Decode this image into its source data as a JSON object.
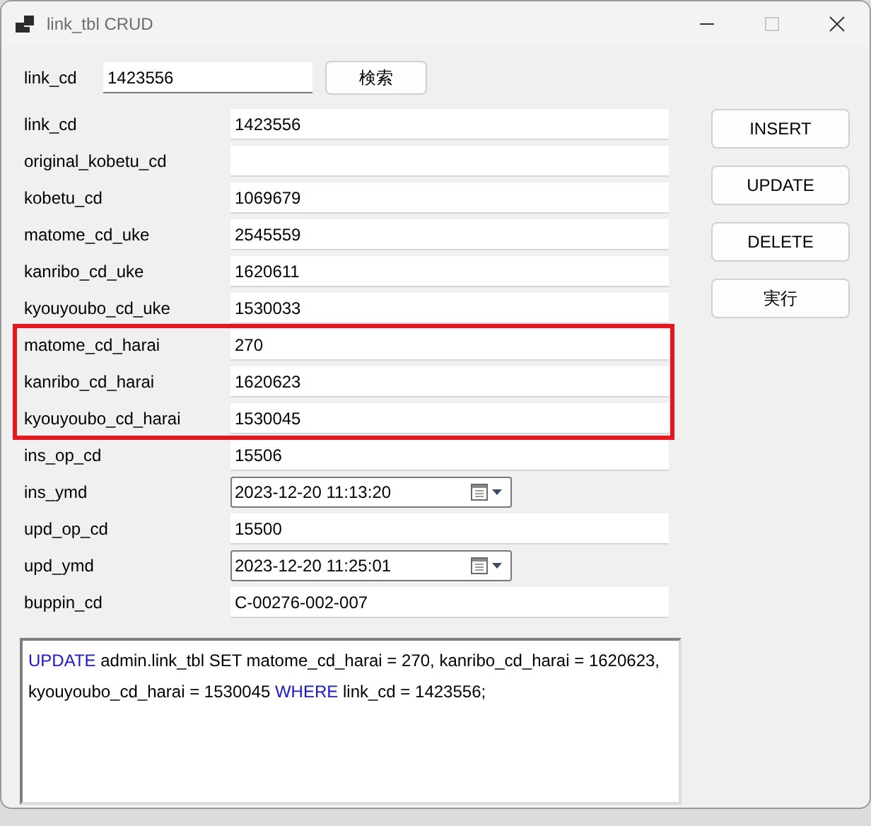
{
  "window": {
    "title": "link_tbl CRUD"
  },
  "search": {
    "label": "link_cd",
    "value": "1423556",
    "button": "検索"
  },
  "field_groups": [
    {
      "highlighted": false,
      "fields": [
        {
          "kind": "text",
          "label": "link_cd",
          "value": "1423556"
        },
        {
          "kind": "text",
          "label": "original_kobetu_cd"
        },
        {
          "kind": "text",
          "label": "kobetu_cd",
          "value": "1069679"
        },
        {
          "kind": "text",
          "label": "matome_cd_uke",
          "value": "2545559"
        },
        {
          "kind": "text",
          "label": "kanribo_cd_uke",
          "value": "1620611"
        },
        {
          "kind": "text",
          "label": "kyouyoubo_cd_uke",
          "value": "1530033"
        }
      ]
    },
    {
      "highlighted": true,
      "fields": [
        {
          "kind": "text",
          "label": "matome_cd_harai",
          "value": "270"
        },
        {
          "kind": "text",
          "label": "kanribo_cd_harai",
          "value": "1620623"
        },
        {
          "kind": "text",
          "label": "kyouyoubo_cd_harai",
          "value": "1530045"
        }
      ]
    },
    {
      "highlighted": false,
      "fields": [
        {
          "kind": "text",
          "label": "ins_op_cd",
          "value": "15506"
        },
        {
          "kind": "date",
          "label": "ins_ymd",
          "value": "2023-12-20 11:13:20"
        },
        {
          "kind": "text",
          "label": "upd_op_cd",
          "value": "15500"
        },
        {
          "kind": "date",
          "label": "upd_ymd",
          "value": "2023-12-20 11:25:01"
        },
        {
          "kind": "text",
          "label": "buppin_cd",
          "value": "C-00276-002-007"
        }
      ]
    }
  ],
  "actions": [
    "INSERT",
    "UPDATE",
    "DELETE",
    "実行"
  ],
  "sql": [
    {
      "kind": "keyword",
      "text": "UPDATE"
    },
    {
      "kind": "plain",
      "text": " admin.link_tbl SET matome_cd_harai = 270, kanribo_cd_harai = 1620623, kyouyoubo_cd_harai = 1530045 "
    },
    {
      "kind": "keyword",
      "text": "WHERE"
    },
    {
      "kind": "plain",
      "text": " link_cd = 1423556;"
    }
  ]
}
